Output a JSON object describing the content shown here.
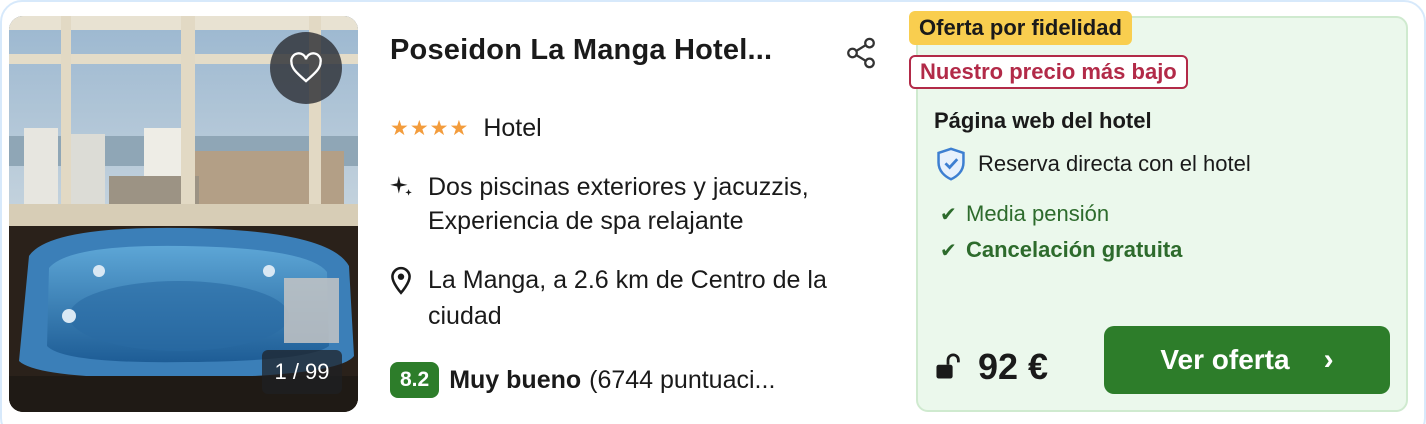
{
  "image": {
    "counter": "1 / 99"
  },
  "hotel": {
    "name": "Poseidon La Manga Hotel...",
    "stars": "★★★★",
    "type": "Hotel",
    "features": "Dos piscinas exteriores y jacuzzis, Experiencia de spa relajante",
    "location": "La Manga, a 2.6 km de Centro de la ciudad"
  },
  "rating": {
    "score": "8.2",
    "label": "Muy bueno",
    "count": "(6744 puntuaci..."
  },
  "offer": {
    "badge_loyalty": "Oferta por fidelidad",
    "badge_lowest": "Nuestro precio más bajo",
    "provider": "Página web del hotel",
    "direct": "Reserva directa con el hotel",
    "perks": [
      "Media pensión",
      "Cancelación gratuita"
    ],
    "price": "92 €",
    "cta": "Ver oferta"
  },
  "icons": {
    "favorite": "heart-icon",
    "share": "share-icon",
    "feature": "sparkle-icon",
    "location": "map-pin-icon",
    "shield": "shield-check-icon",
    "check": "check-icon",
    "lock": "unlock-icon",
    "chevron": "chevron-right-icon"
  },
  "colors": {
    "primary_green": "#2d7d2a",
    "offer_bg": "#ebf8ec",
    "loyalty_yellow": "#f9ce4f",
    "lowest_red": "#b22a48",
    "star_orange": "#f39c3c"
  }
}
